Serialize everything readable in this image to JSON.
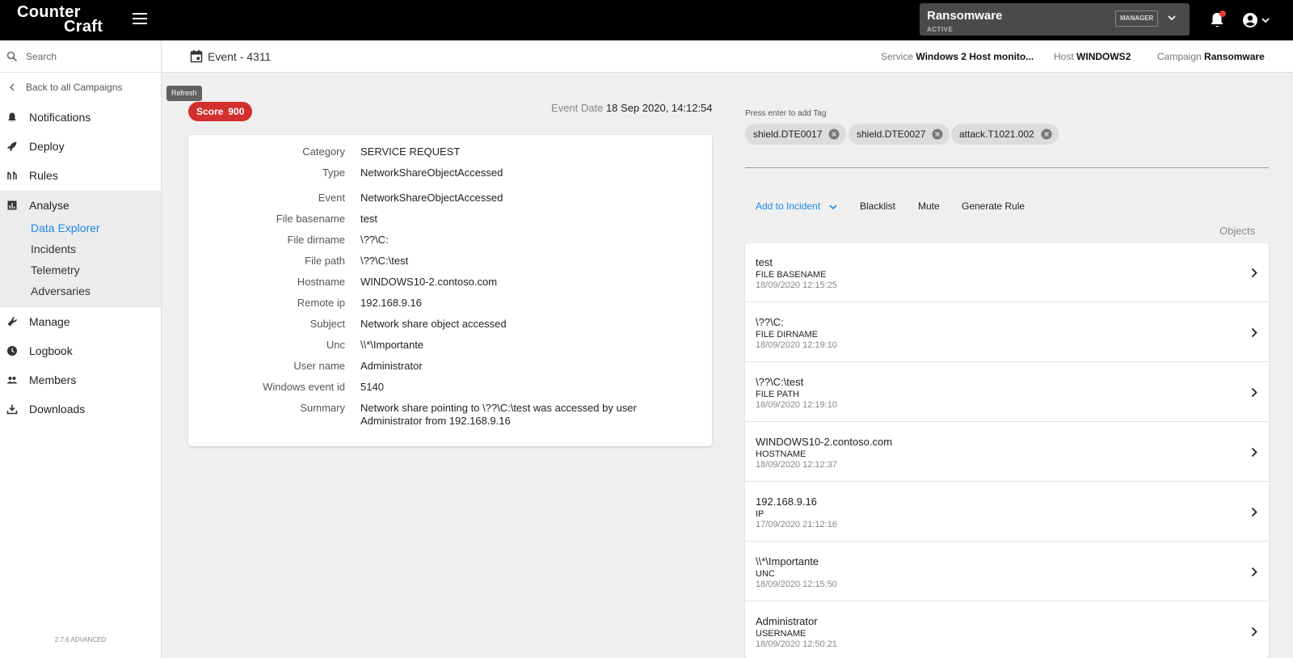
{
  "brand": {
    "line1": "Counter",
    "line2": "Craft"
  },
  "campaign_selector": {
    "name": "Ransomware",
    "status": "ACTIVE",
    "role": "MANAGER"
  },
  "search": {
    "placeholder": "Search"
  },
  "sidebar": {
    "back_label": "Back to all Campaigns",
    "items": [
      {
        "label": "Notifications",
        "icon": "bell-icon"
      },
      {
        "label": "Deploy",
        "icon": "rocket-icon"
      },
      {
        "label": "Rules",
        "icon": "rules-icon"
      },
      {
        "label": "Analyse",
        "icon": "chart-icon"
      },
      {
        "label": "Manage",
        "icon": "wrench-icon"
      },
      {
        "label": "Logbook",
        "icon": "clock-icon"
      },
      {
        "label": "Members",
        "icon": "people-icon"
      },
      {
        "label": "Downloads",
        "icon": "download-icon"
      }
    ],
    "analyse_sub": [
      "Data Explorer",
      "Incidents",
      "Telemetry",
      "Adversaries"
    ],
    "active_sub": "Data Explorer",
    "version": "2.7.6 ADVANCED"
  },
  "header": {
    "title": "Event - 4311",
    "service_label": "Service",
    "service_value": "Windows 2 Host monito...",
    "host_label": "Host",
    "host_value": "WINDOWS2",
    "campaign_label": "Campaign",
    "campaign_value": "Ransomware"
  },
  "tooltip": "Refresh",
  "score": {
    "label": "Score",
    "value": "900",
    "color": "#d32f2f"
  },
  "event_date": {
    "label": "Event Date",
    "value": "18 Sep 2020, 14:12:54"
  },
  "details": [
    {
      "key": "Category",
      "value": "SERVICE REQUEST"
    },
    {
      "key": "Type",
      "value": "NetworkShareObjectAccessed"
    },
    {
      "key": "Event",
      "value": "NetworkShareObjectAccessed"
    },
    {
      "key": "File basename",
      "value": "test"
    },
    {
      "key": "File dirname",
      "value": "\\??\\C:"
    },
    {
      "key": "File path",
      "value": "\\??\\C:\\test"
    },
    {
      "key": "Hostname",
      "value": "WINDOWS10-2.contoso.com"
    },
    {
      "key": "Remote ip",
      "value": "192.168.9.16"
    },
    {
      "key": "Subject",
      "value": "Network share object accessed"
    },
    {
      "key": "Unc",
      "value": "\\\\*\\Importante"
    },
    {
      "key": "User name",
      "value": "Administrator"
    },
    {
      "key": "Windows event id",
      "value": "5140"
    },
    {
      "key": "Summary",
      "value": "Network share pointing to \\??\\C:\\test was accessed by user Administrator from 192.168.9.16"
    }
  ],
  "tags": {
    "hint": "Press enter to add Tag",
    "items": [
      "shield.DTE0017",
      "shield.DTE0027",
      "attack.T1021.002"
    ]
  },
  "actions": {
    "add_to_incident": "Add to Incident",
    "blacklist": "Blacklist",
    "mute": "Mute",
    "generate_rule": "Generate Rule"
  },
  "objects": {
    "label": "Objects",
    "items": [
      {
        "value": "test",
        "type": "FILE BASENAME",
        "timestamp": "18/09/2020 12:15:25"
      },
      {
        "value": "\\??\\C:",
        "type": "FILE DIRNAME",
        "timestamp": "18/09/2020 12:19:10"
      },
      {
        "value": "\\??\\C:\\test",
        "type": "FILE PATH",
        "timestamp": "18/09/2020 12:19:10"
      },
      {
        "value": "WINDOWS10-2.contoso.com",
        "type": "HOSTNAME",
        "timestamp": "18/09/2020 12:12:37"
      },
      {
        "value": "192.168.9.16",
        "type": "IP",
        "timestamp": "17/09/2020 21:12:16"
      },
      {
        "value": "\\\\*\\Importante",
        "type": "UNC",
        "timestamp": "18/09/2020 12:15:50"
      },
      {
        "value": "Administrator",
        "type": "USERNAME",
        "timestamp": "18/09/2020 12:50:21"
      }
    ]
  },
  "colors": {
    "accent": "#1e88e5",
    "topbar": "#000000",
    "danger": "#d32f2f"
  }
}
